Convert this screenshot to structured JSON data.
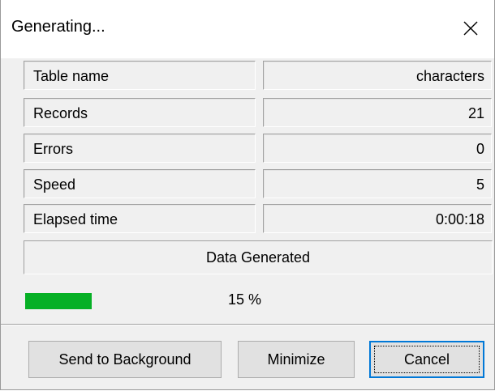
{
  "window": {
    "title": "Generating...",
    "close_icon": "close-icon"
  },
  "stats": [
    {
      "label": "Table name",
      "value": "characters"
    },
    {
      "label": "Records",
      "value": "21"
    },
    {
      "label": "Errors",
      "value": "0"
    },
    {
      "label": "Speed",
      "value": "5"
    },
    {
      "label": "Elapsed time",
      "value": "0:00:18"
    }
  ],
  "status": "Data Generated",
  "progress": {
    "percent": 15,
    "text": "15 %",
    "color": "#06b025"
  },
  "buttons": {
    "send_to_background": "Send to Background",
    "minimize": "Minimize",
    "cancel": "Cancel"
  },
  "colors": {
    "focus_border": "#0078d7"
  }
}
